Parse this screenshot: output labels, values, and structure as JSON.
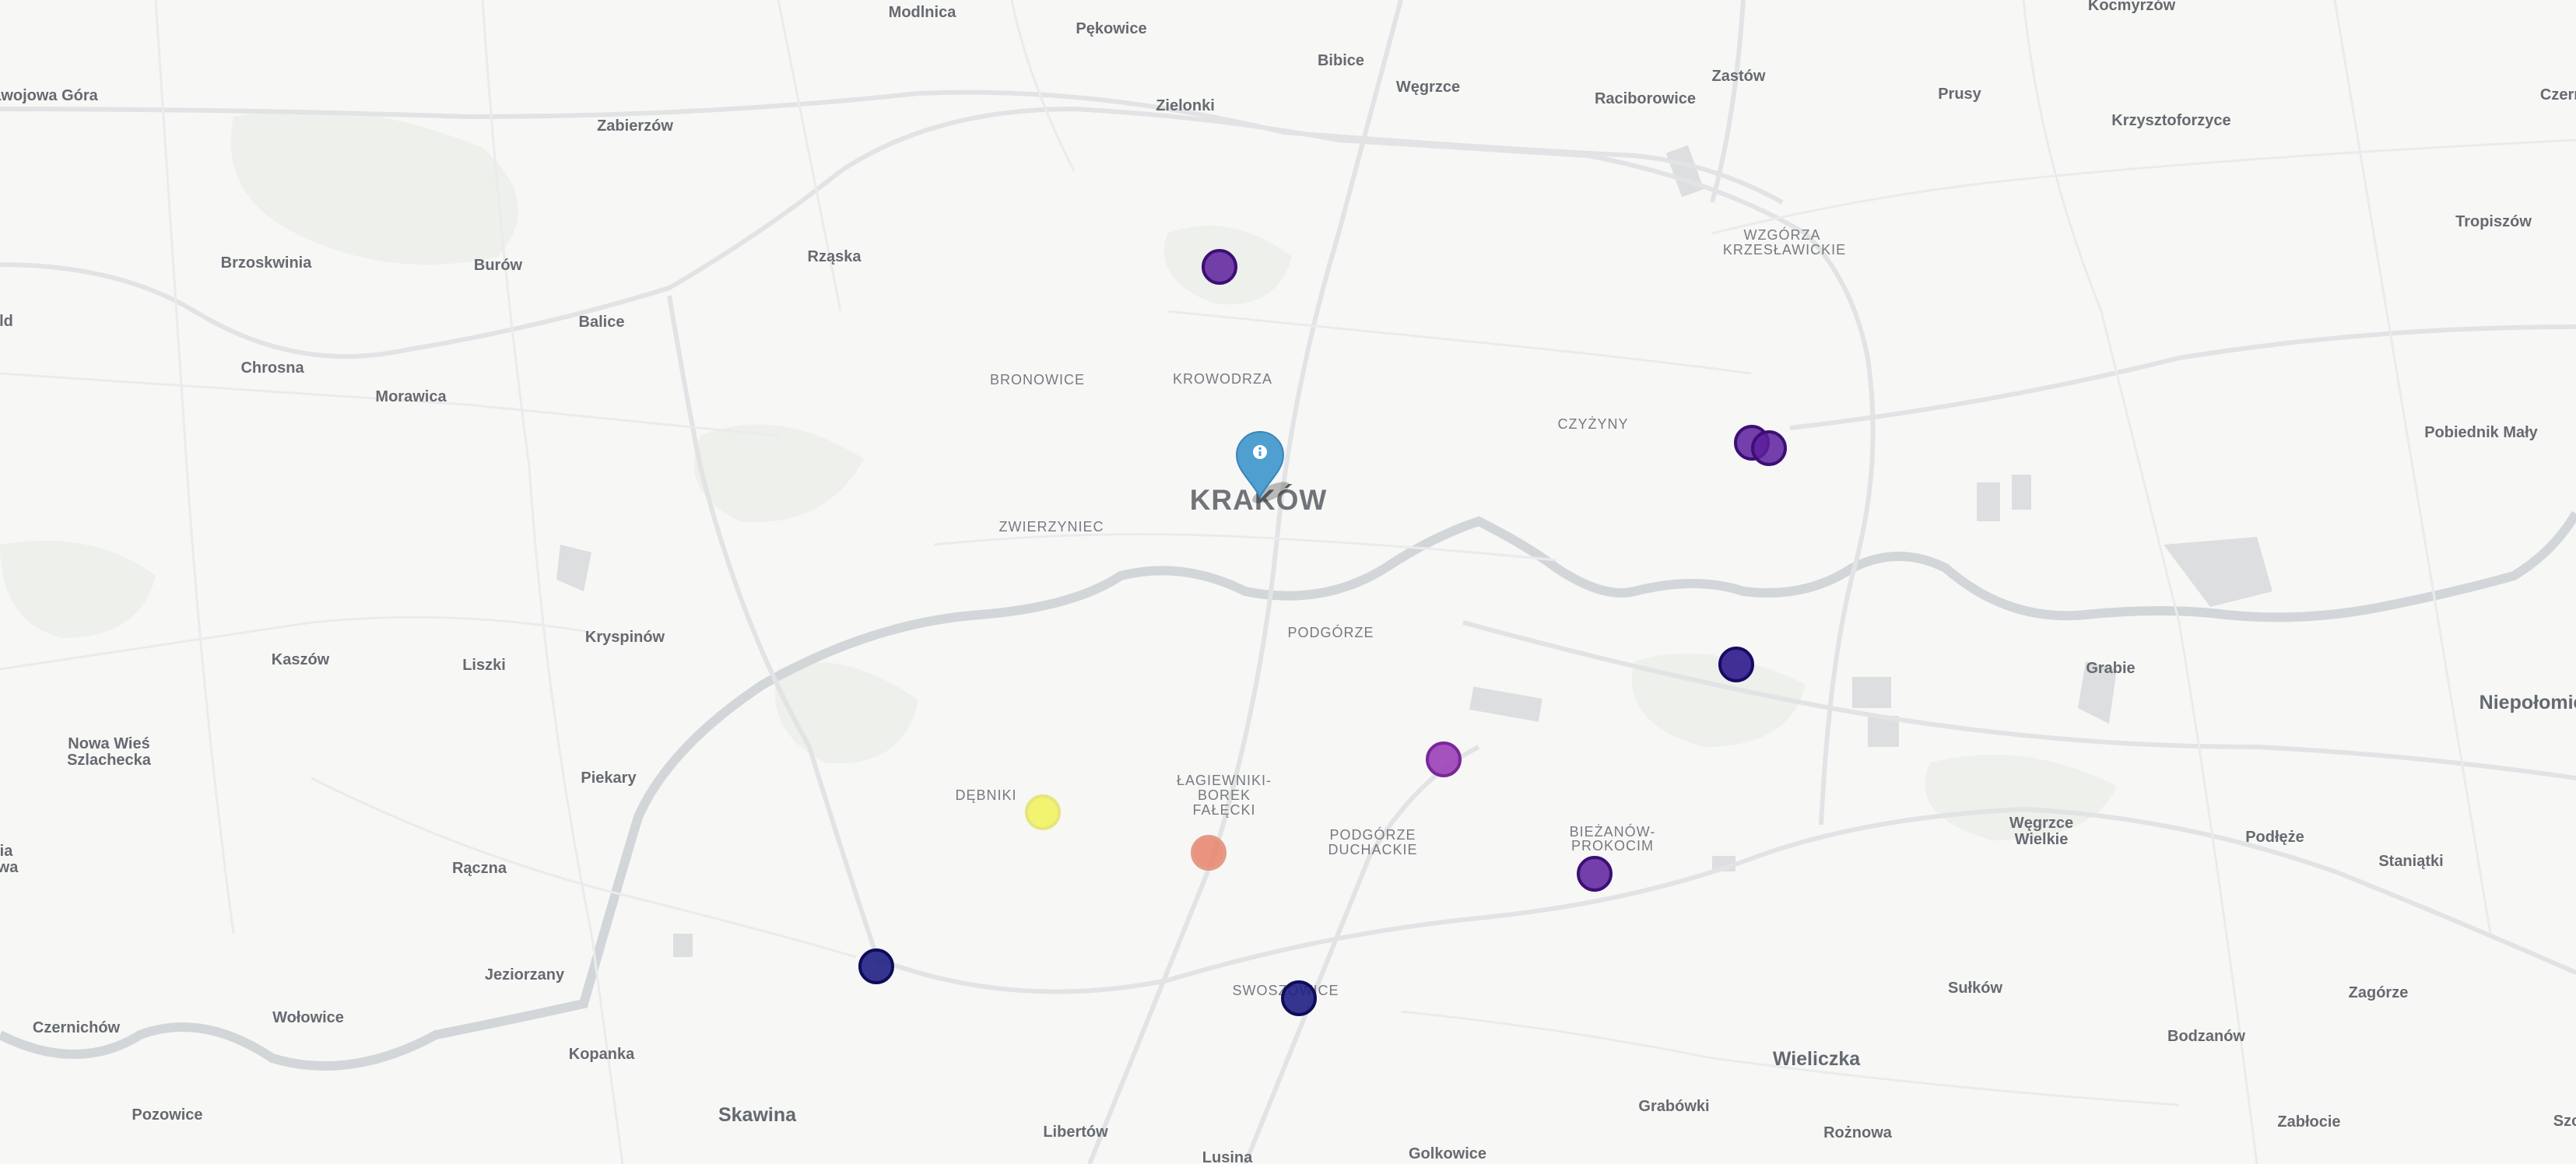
{
  "map": {
    "city": "KRAKÓW",
    "towns": [
      "Skawina",
      "Wieliczka",
      "Niepołomice"
    ],
    "places": [
      "Modlnica",
      "Pękowice",
      "Bibice",
      "Węgrzce",
      "Zastów",
      "Kocmyrzów",
      "Prusy",
      "Krzysztoforzyce",
      "Czernic",
      "Zabierzów",
      "Zielonki",
      "Raciborowice",
      "Tropiszów",
      "awojowa Góra",
      "Brzoskwinia",
      "Burów",
      "Rząska",
      "Balice",
      "Chrosna",
      "Morawica",
      "Pobiednik Mały",
      "Kaszów",
      "Liszki",
      "Kryspinów",
      "Grabie",
      "Nowa Wieś",
      "Szlachecka",
      "Piekary",
      "Rączna",
      "Jeziorzany",
      "Wołowice",
      "Czernichów",
      "Kopanka",
      "Pozowice",
      "Libertów",
      "Lusina",
      "Golkowice",
      "Grabówki",
      "Rożnowa",
      "Zabłocie",
      "Bodzanów",
      "Sułków",
      "Zagórze",
      "Staniątki",
      "Podłęże",
      "Węgrzce",
      "Wielkie",
      "Szc",
      "ia",
      "wa",
      "ld"
    ],
    "districts": [
      "BRONOWICE",
      "KROWODRZA",
      "ZWIERZYNIEC",
      "CZYŻYNY",
      "WZGÓRZA",
      "KRZESŁAWICKIE",
      "PODGÓRZE",
      "DĘBNIKI",
      "ŁAGIEWNIKI-",
      "BOREK",
      "FAŁĘCKI",
      "PODGÓRZE",
      "DUCHACKIE",
      "BIEŻANÓW-",
      "PROKOCIM",
      "SWOSZOWICE"
    ],
    "info_marker": {
      "icon": "info-icon",
      "color": "#4f9fd0"
    },
    "markers": [
      {
        "name": "north-krowodrza",
        "color": "#5c1f9c"
      },
      {
        "name": "czyzyny-a",
        "color": "#5c1f9c"
      },
      {
        "name": "czyzyny-b",
        "color": "#5c1f9c"
      },
      {
        "name": "east-nowa-huta",
        "color": "#2d1a8c"
      },
      {
        "name": "podgorze-east",
        "color": "#9a3fb8"
      },
      {
        "name": "biezanow",
        "color": "#5c1f9c"
      },
      {
        "name": "debniki",
        "color": "#f2f25a"
      },
      {
        "name": "lagiewniki",
        "color": "#e8836a"
      },
      {
        "name": "skawina-north",
        "color": "#1f1f85"
      },
      {
        "name": "swoszowice",
        "color": "#1f1f85"
      }
    ]
  }
}
